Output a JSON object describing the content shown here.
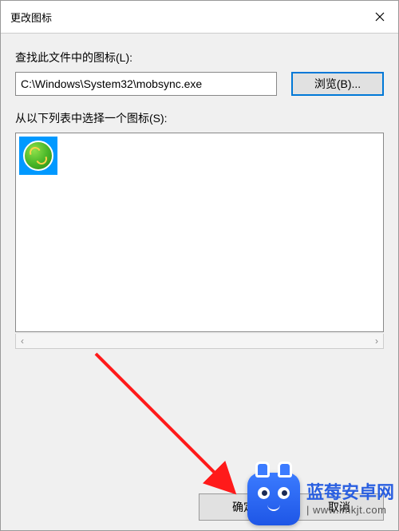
{
  "titlebar": {
    "title": "更改图标"
  },
  "labels": {
    "look_for_icons": "查找此文件中的图标(L):",
    "select_from_list": "从以下列表中选择一个图标(S):"
  },
  "path_input": {
    "value": "C:\\Windows\\System32\\mobsync.exe"
  },
  "buttons": {
    "browse": "浏览(B)...",
    "ok": "确定",
    "cancel": "取消"
  },
  "icons": [
    {
      "name": "sync-icon"
    }
  ],
  "scroll": {
    "left": "‹",
    "right": "›"
  },
  "watermark": {
    "title": "蓝莓安卓网",
    "url": "| www.lmkjt.com"
  }
}
